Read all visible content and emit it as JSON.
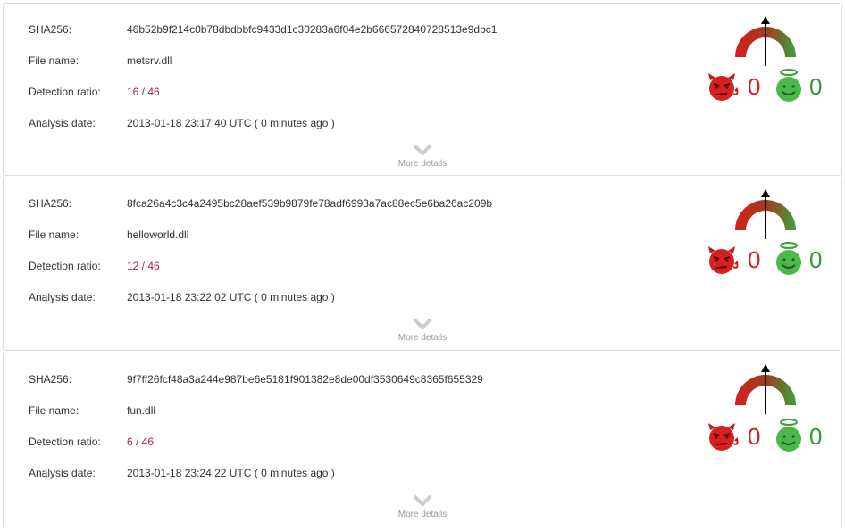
{
  "labels": {
    "sha": "SHA256:",
    "file": "File name:",
    "ratio": "Detection ratio:",
    "date": "Analysis date:",
    "more": "More details"
  },
  "reports": [
    {
      "sha256": "46b52b9f214c0b78dbdbbfc9433d1c30283a6f04e2b666572840728513e9dbc1",
      "file_name": "metsrv.dll",
      "detection_ratio": "16 / 46",
      "analysis_date": "2013-01-18 23:17:40 UTC ( 0 minutes ago )",
      "malicious_votes": "0",
      "harmless_votes": "0"
    },
    {
      "sha256": "8fca26a4c3c4a2495bc28aef539b9879fe78adf6993a7ac88ec5e6ba26ac209b",
      "file_name": "helloworld.dll",
      "detection_ratio": "12 / 46",
      "analysis_date": "2013-01-18 23:22:02 UTC ( 0 minutes ago )",
      "malicious_votes": "0",
      "harmless_votes": "0"
    },
    {
      "sha256": "9f7ff26fcf48a3a244e987be6e5181f901382e8de00df3530649c8365f655329",
      "file_name": "fun.dll",
      "detection_ratio": "6 / 46",
      "analysis_date": "2013-01-18 23:24:22 UTC ( 0 minutes ago )",
      "malicious_votes": "0",
      "harmless_votes": "0"
    }
  ],
  "icons": {
    "gauge": "community-score-gauge-icon",
    "devil": "devil-face-icon",
    "angel": "angel-face-icon",
    "chevron": "chevron-down-icon"
  },
  "colors": {
    "ratio": "#a0283c",
    "malicious": "#d42020",
    "harmless": "#2f9a2f"
  }
}
